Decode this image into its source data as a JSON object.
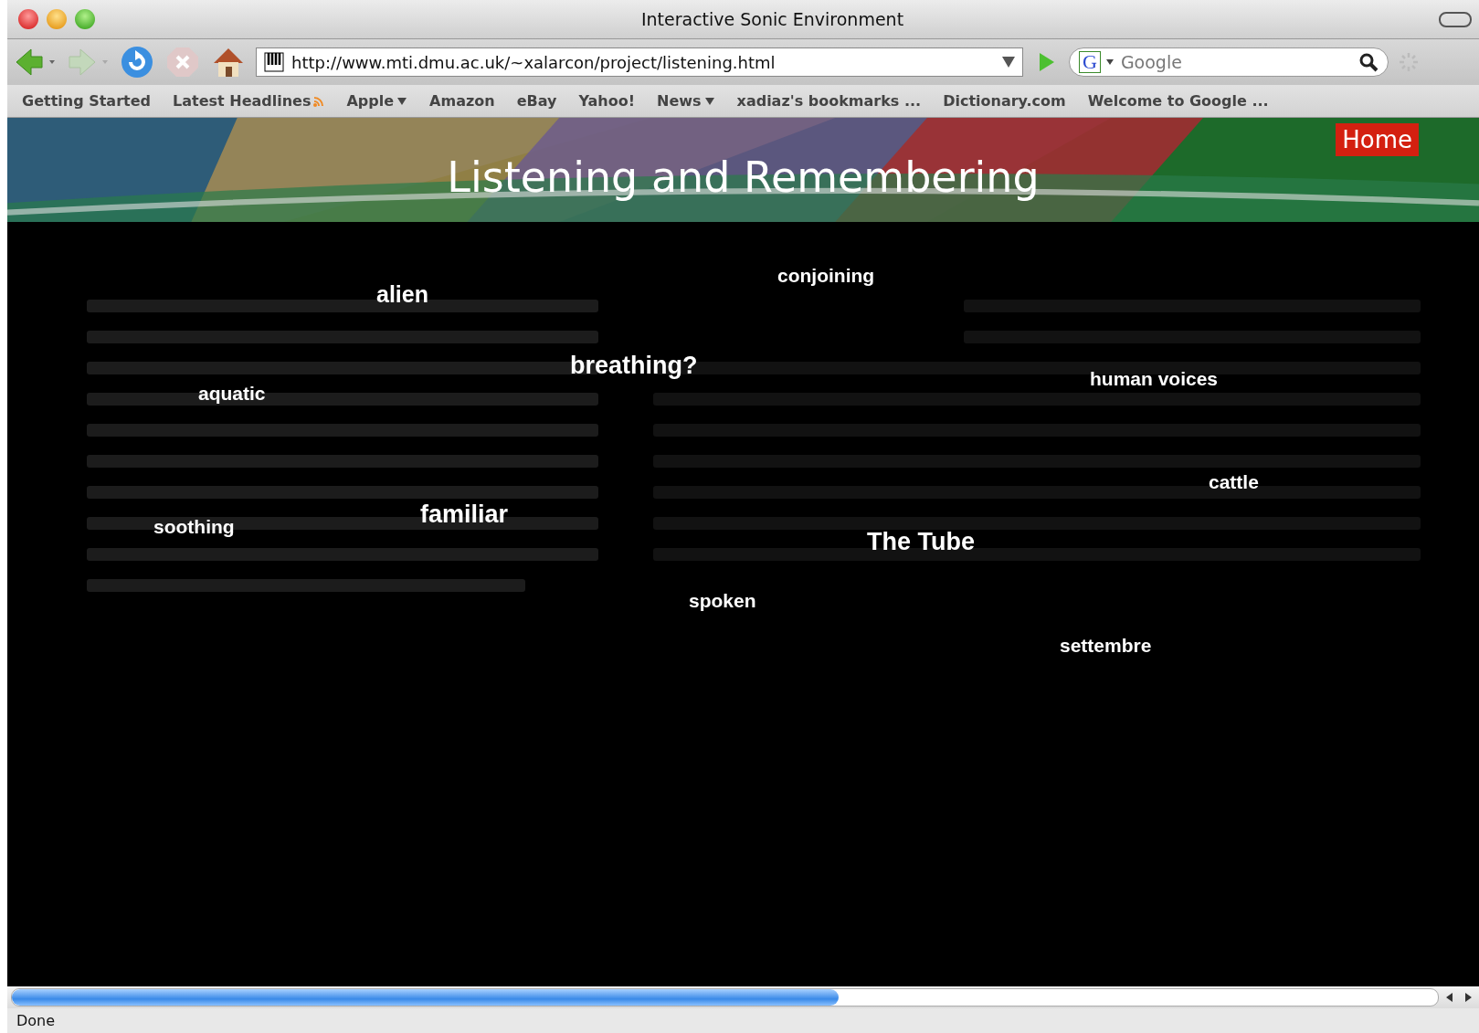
{
  "window": {
    "title": "Interactive Sonic Environment"
  },
  "toolbar": {
    "url": "http://www.mti.dmu.ac.uk/~xalarcon/project/listening.html",
    "search": {
      "placeholder": "Google",
      "engine_letter": "G"
    }
  },
  "bookmarks": [
    {
      "label": "Getting Started",
      "kind": "plain"
    },
    {
      "label": "Latest Headlines",
      "kind": "feed"
    },
    {
      "label": "Apple",
      "kind": "menu"
    },
    {
      "label": "Amazon",
      "kind": "plain"
    },
    {
      "label": "eBay",
      "kind": "plain"
    },
    {
      "label": "Yahoo!",
      "kind": "plain"
    },
    {
      "label": "News",
      "kind": "menu"
    },
    {
      "label": "xadiaz's bookmarks ...",
      "kind": "plain"
    },
    {
      "label": "Dictionary.com",
      "kind": "plain"
    },
    {
      "label": "Welcome to Google ...",
      "kind": "plain"
    }
  ],
  "banner": {
    "title": "Listening and Remembering",
    "home_link": "Home"
  },
  "words": [
    {
      "text": "conjoining",
      "kind": "small"
    },
    {
      "text": "alien",
      "kind": "medium"
    },
    {
      "text": "breathing?",
      "kind": "large"
    },
    {
      "text": "aquatic",
      "kind": "small"
    },
    {
      "text": "human voices",
      "kind": "small"
    },
    {
      "text": "cattle",
      "kind": "small"
    },
    {
      "text": "soothing",
      "kind": "small"
    },
    {
      "text": "familiar",
      "kind": "large"
    },
    {
      "text": "The Tube",
      "kind": "large"
    },
    {
      "text": "spoken",
      "kind": "small"
    },
    {
      "text": "settembre",
      "kind": "small"
    }
  ],
  "status_bar": {
    "text": "Done"
  }
}
